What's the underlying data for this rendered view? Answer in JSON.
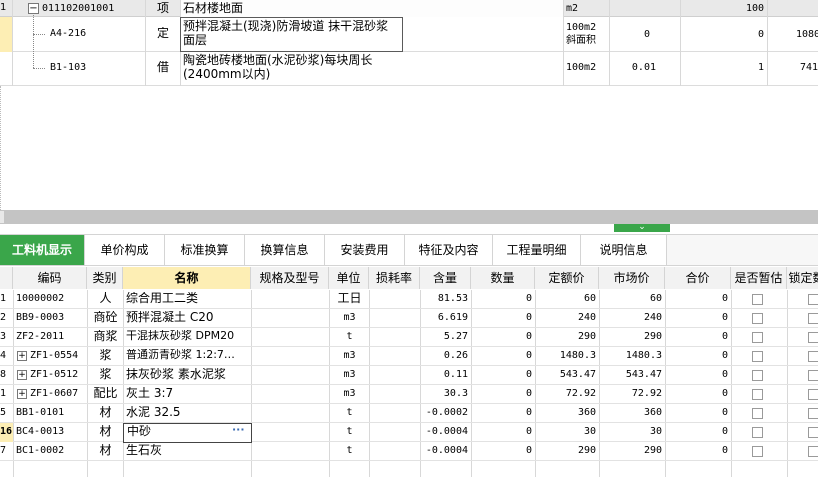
{
  "top_rows": [
    {
      "num": "1",
      "expander": "−",
      "code": "011102001001",
      "type": "项",
      "name": "石材楼地面",
      "unit": "m2",
      "qty": "",
      "price1": "100",
      "price2": ""
    },
    {
      "num": "",
      "expander": "",
      "code": "A4-216",
      "type": "定",
      "name": "预拌混凝土(现浇)防滑坡道 抹干混砂浆\n面层",
      "unit": "100m2\n斜面积",
      "qty": "0",
      "price1": "0",
      "price2": "1080"
    },
    {
      "num": "",
      "expander": "",
      "code": "B1-103",
      "type": "借",
      "name": "陶瓷地砖楼地面(水泥砂浆)每块周长\n(2400mm以内)",
      "unit": "100m2",
      "qty": "0.01",
      "price1": "1",
      "price2": "741"
    }
  ],
  "collapse_arrow": "⌄",
  "tabs": [
    "工料机显示",
    "单价构成",
    "标准换算",
    "换算信息",
    "安装费用",
    "特征及内容",
    "工程量明细",
    "说明信息"
  ],
  "columns": [
    "",
    "编码",
    "类别",
    "名称",
    "规格及型号",
    "单位",
    "损耗率",
    "含量",
    "数量",
    "定额价",
    "市场价",
    "合价",
    "是否暂估",
    "锁定数"
  ],
  "rows": [
    {
      "num": "1",
      "exp": "",
      "code": "10000002",
      "cat": "人",
      "name": "综合用工二类",
      "spec": "",
      "unit": "工日",
      "loss": "",
      "content": "81.53",
      "qty": "0",
      "quota": "60",
      "market": "60",
      "total": "0"
    },
    {
      "num": "2",
      "exp": "",
      "code": "BB9-0003",
      "cat": "商砼",
      "name": "预拌混凝土 C20",
      "spec": "",
      "unit": "m3",
      "loss": "",
      "content": "6.619",
      "qty": "0",
      "quota": "240",
      "market": "240",
      "total": "0"
    },
    {
      "num": "3",
      "exp": "",
      "code": "ZF2-2011",
      "cat": "商浆",
      "name": "干混抹灰砂浆 DPM20",
      "spec": "",
      "unit": "t",
      "loss": "",
      "content": "5.27",
      "qty": "0",
      "quota": "290",
      "market": "290",
      "total": "0"
    },
    {
      "num": "4",
      "exp": "+",
      "code": "ZF1-0554",
      "cat": "浆",
      "name": "普通沥青砂浆 1:2:7…",
      "spec": "",
      "unit": "m3",
      "loss": "",
      "content": "0.26",
      "qty": "0",
      "quota": "1480.3",
      "market": "1480.3",
      "total": "0"
    },
    {
      "num": "8",
      "exp": "+",
      "code": "ZF1-0512",
      "cat": "浆",
      "name": "抹灰砂浆 素水泥浆",
      "spec": "",
      "unit": "m3",
      "loss": "",
      "content": "0.11",
      "qty": "0",
      "quota": "543.47",
      "market": "543.47",
      "total": "0"
    },
    {
      "num": "1",
      "exp": "+",
      "code": "ZF1-0607",
      "cat": "配比",
      "name": "灰土 3:7",
      "spec": "",
      "unit": "m3",
      "loss": "",
      "content": "30.3",
      "qty": "0",
      "quota": "72.92",
      "market": "72.92",
      "total": "0"
    },
    {
      "num": "5",
      "exp": "",
      "code": "BB1-0101",
      "cat": "材",
      "name": "水泥 32.5",
      "spec": "",
      "unit": "t",
      "loss": "",
      "content": "-0.0002",
      "qty": "0",
      "quota": "360",
      "market": "360",
      "total": "0"
    },
    {
      "num": "16",
      "exp": "",
      "code": "BC4-0013",
      "cat": "材",
      "name": "中砂",
      "spec": "",
      "unit": "t",
      "loss": "",
      "content": "-0.0004",
      "qty": "0",
      "quota": "30",
      "market": "30",
      "total": "0"
    },
    {
      "num": "7",
      "exp": "",
      "code": "BC1-0002",
      "cat": "材",
      "name": "生石灰",
      "spec": "",
      "unit": "t",
      "loss": "",
      "content": "-0.0004",
      "qty": "0",
      "quota": "290",
      "market": "290",
      "total": "0"
    },
    {
      "num": "",
      "exp": "",
      "code": "",
      "cat": "",
      "name": "",
      "spec": "",
      "unit": "",
      "loss": "",
      "content": "",
      "qty": "",
      "quota": "",
      "market": "",
      "total": ""
    }
  ],
  "edit_ellipsis": "···",
  "colors": {
    "accent": "#3aa64a",
    "header_yellow": "#fdeeb4",
    "selected_row": "#fff3c8",
    "splitter": "#c0c0c0"
  }
}
